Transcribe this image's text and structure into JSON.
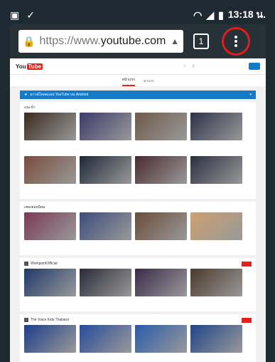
{
  "status": {
    "time": "13:18 น.",
    "left_icons": [
      "image-icon",
      "clipboard-check-icon"
    ]
  },
  "browser": {
    "url_scheme": "https://www.",
    "url_host": "youtube.com",
    "tab_count": "1"
  },
  "youtube": {
    "logo_you": "You",
    "logo_tube": "Tube",
    "nav": [
      "หน้าแรก",
      "มาแรง"
    ],
    "banner": "ดาวน์โหลดแอป YouTube บน Android",
    "sections": [
      {
        "title": "แนะนำ",
        "has_subscribe": false,
        "rows": [
          [
            {
              "c": "#3a2a20"
            },
            {
              "c": "#3c3a6a"
            },
            {
              "c": "#6d5a4a"
            },
            {
              "c": "#2d3348"
            }
          ],
          [
            {
              "c": "#7a4c3a"
            },
            {
              "c": "#1e2838"
            },
            {
              "c": "#4a2a30"
            },
            {
              "c": "#2b3040"
            }
          ]
        ]
      },
      {
        "title": "เพลงยอดนิยม",
        "has_subscribe": false,
        "rows": [
          [
            {
              "c": "#7a3a55"
            },
            {
              "c": "#3d4c7a"
            },
            {
              "c": "#6a4c3a"
            },
            {
              "c": "#caa070"
            }
          ]
        ]
      },
      {
        "title": "WorkpointOfficial",
        "has_subscribe": true,
        "rows": [
          [
            {
              "c": "#1e3a6a"
            },
            {
              "c": "#2a2a3a"
            },
            {
              "c": "#3a2a4a"
            },
            {
              "c": "#4a3a2a"
            }
          ]
        ]
      },
      {
        "title": "The Voice Kids Thailand",
        "has_subscribe": true,
        "rows": [
          [
            {
              "c": "#1d3e8a"
            },
            {
              "c": "#284a9a"
            },
            {
              "c": "#2a5aaa"
            },
            {
              "c": "#224488"
            }
          ]
        ]
      }
    ]
  }
}
